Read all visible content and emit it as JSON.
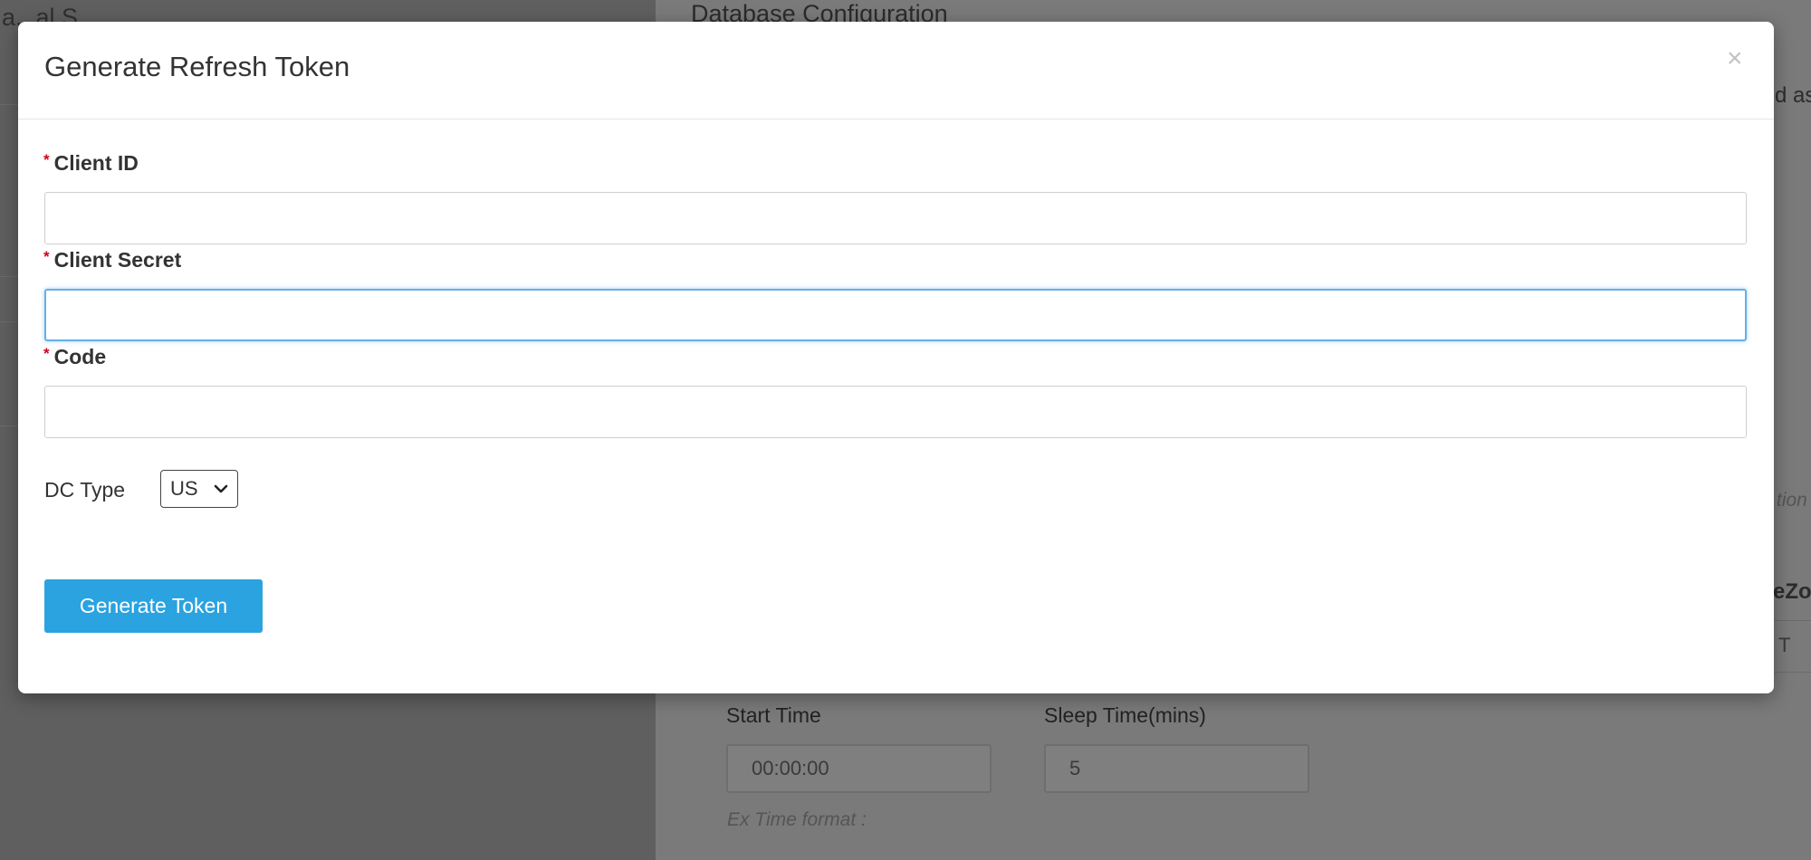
{
  "modal": {
    "title": "Generate Refresh Token",
    "close_glyph": "×",
    "fields": [
      {
        "label": "Client ID",
        "required": true,
        "value": "",
        "focused": false
      },
      {
        "label": "Client Secret",
        "required": true,
        "value": "",
        "focused": true
      },
      {
        "label": "Code",
        "required": true,
        "value": "",
        "focused": false
      }
    ],
    "required_marker": "*",
    "dc_type": {
      "label": "DC Type",
      "selected": "US"
    },
    "generate_button": "Generate Token"
  },
  "background": {
    "left_title_fragment": "a...al S...",
    "section_title": "Database Configuration",
    "right_edge_fragment_1": "d as",
    "right_edge_fragment_2": "tion",
    "right_edge_fragment_3": "eZo",
    "right_edge_fragment_4": "T",
    "start_time": {
      "label": "Start Time",
      "value": "00:00:00",
      "hint": "Ex Time format :"
    },
    "sleep_time": {
      "label": "Sleep Time(mins)",
      "value": "5"
    }
  },
  "colors": {
    "overlay_left": "#5f5f5f",
    "overlay_right": "#7a7a7a",
    "primary_button": "#2aa3e0",
    "required_marker": "#d0021b",
    "focus_border": "#66afe9"
  },
  "icons": {
    "close": "close-icon",
    "select_chevron": "chevron-down-icon"
  }
}
